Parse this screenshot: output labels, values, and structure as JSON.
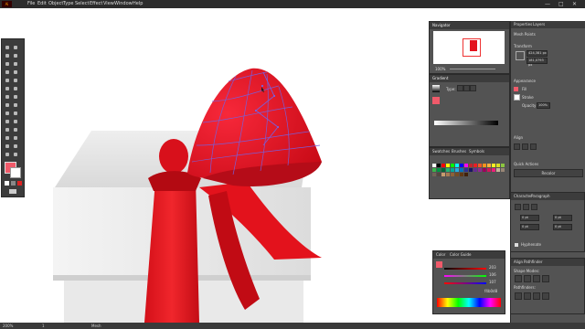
{
  "app": {
    "logo": "Ai"
  },
  "menus": [
    "File",
    "Edit",
    "Object",
    "Type",
    "Select",
    "Effect",
    "View",
    "Window",
    "Help"
  ],
  "window_controls": {
    "minimize": "—",
    "maximize": "□",
    "close": "✕"
  },
  "colors": {
    "ui_dark": "#2c2c2c",
    "panel": "#535353",
    "accent_red": "#e8141d",
    "selection_purple": "#7b5cd6",
    "box_white": "#e6e6e6",
    "ribbon_red": "#ea1a20"
  },
  "navigator": {
    "title": "Navigator",
    "zoom": "100%"
  },
  "gradient": {
    "title": "Gradient",
    "type_label": "Type:"
  },
  "swatches": {
    "tabs": [
      "Swatches",
      "Brushes",
      "Symbols"
    ]
  },
  "color_panel": {
    "tabs": [
      "Color",
      "Color Guide"
    ],
    "values": [
      "203",
      "106",
      "107"
    ],
    "hex": "f4b0d8"
  },
  "properties": {
    "tabs": [
      "Properties",
      "Layers"
    ],
    "selection": "Mesh Points",
    "transform_label": "Transform",
    "x": "424,381 px",
    "y": "181,0793 px",
    "appearance_label": "Appearance",
    "fill_label": "Fill",
    "stroke_label": "Stroke",
    "opacity_label": "Opacity",
    "opacity_value": "100%",
    "align_label": "Align",
    "quick_actions_label": "Quick Actions",
    "quick_action_button": "Recolor"
  },
  "character": {
    "tabs": [
      "Character",
      "Paragraph"
    ],
    "values": [
      "0 pt",
      "0 pt",
      "0 pt",
      "0 pt"
    ],
    "hyphenate_label": "Hyphenate"
  },
  "pathfinder": {
    "tabs": [
      "Align",
      "Pathfinder"
    ],
    "shape_modes_label": "Shape Modes:",
    "pathfinders_label": "Pathfinders:"
  },
  "status": {
    "zoom": "200%",
    "page": "1",
    "tool": "Mesh"
  }
}
